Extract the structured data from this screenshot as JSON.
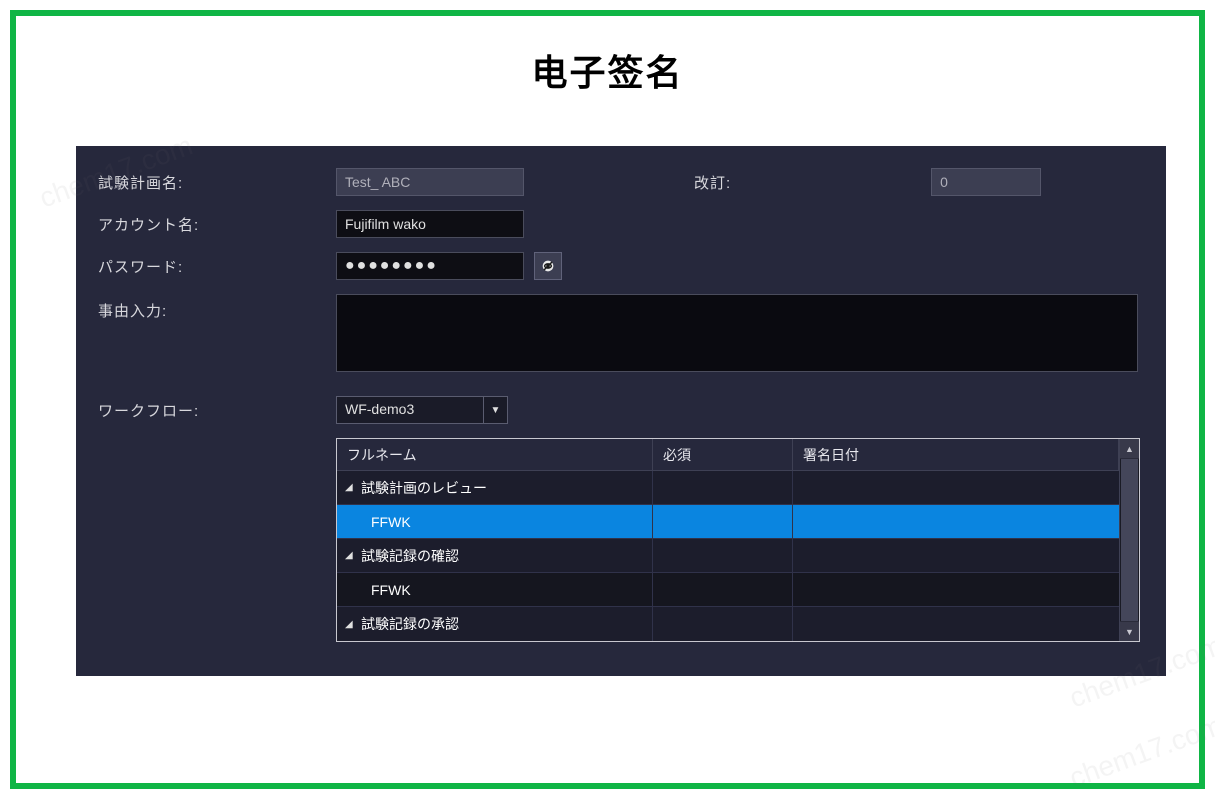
{
  "pageTitle": "电子签名",
  "labels": {
    "testPlanName": "試験計画名:",
    "revision": "改訂:",
    "accountName": "アカウント名:",
    "password": "パスワード:",
    "reason": "事由入力:",
    "workflow": "ワークフロー:"
  },
  "values": {
    "testPlanName": "Test_ ABC",
    "revision": "0",
    "accountName": "Fujifilm wako",
    "passwordMask": "●●●●●●●●",
    "reason": "",
    "workflow": "WF-demo3"
  },
  "table": {
    "headers": {
      "fullName": "フルネーム",
      "required": "必須",
      "sigDate": "署名日付"
    },
    "rows": [
      {
        "type": "group",
        "name": "試験計画のレビュー"
      },
      {
        "type": "child",
        "name": "FFWK",
        "selected": true
      },
      {
        "type": "group",
        "name": "試験記録の確認"
      },
      {
        "type": "child",
        "name": "FFWK"
      },
      {
        "type": "group",
        "name": "試験記録の承認"
      }
    ]
  },
  "watermark": "chem17.com"
}
